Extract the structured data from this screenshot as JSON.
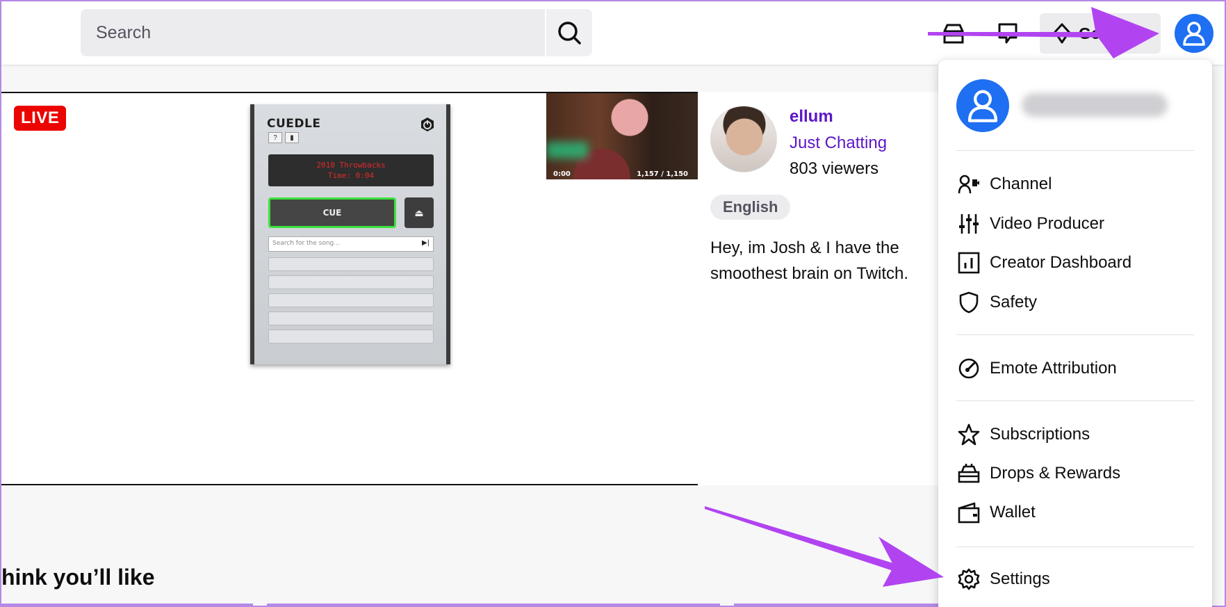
{
  "search": {
    "placeholder": "Search"
  },
  "header": {
    "get_label": "Get"
  },
  "stream": {
    "live_label": "LIVE",
    "channel_name": "ellum",
    "category": "Just Chatting",
    "viewers": "803 viewers",
    "tag": "English",
    "description": "Hey, im Josh & I have the smoothest brain on Twitch."
  },
  "cuedle": {
    "title": "CUEDLE",
    "display_line1": "2010 Throwbacks",
    "display_line2": "Time: 0:04",
    "cue_label": "CUE",
    "search_placeholder": "Search for the song..."
  },
  "thumbnail": {
    "time": "0:00",
    "stats": "1,157 / 1,150"
  },
  "section": {
    "heading": "hink you’ll like"
  },
  "menu": {
    "items": [
      {
        "label": "Channel",
        "icon": "channel-icon"
      },
      {
        "label": "Video Producer",
        "icon": "sliders-icon"
      },
      {
        "label": "Creator Dashboard",
        "icon": "dashboard-icon"
      },
      {
        "label": "Safety",
        "icon": "shield-icon"
      },
      {
        "label": "Emote Attribution",
        "icon": "gauge-icon"
      },
      {
        "label": "Subscriptions",
        "icon": "star-icon"
      },
      {
        "label": "Drops & Rewards",
        "icon": "drops-icon"
      },
      {
        "label": "Wallet",
        "icon": "wallet-icon"
      },
      {
        "label": "Settings",
        "icon": "gear-icon"
      }
    ]
  },
  "colors": {
    "accent_purple": "#5c16c5",
    "avatar_blue": "#1e6ff2",
    "live_red": "#eb0400",
    "annotation_arrow": "#b144f0"
  }
}
